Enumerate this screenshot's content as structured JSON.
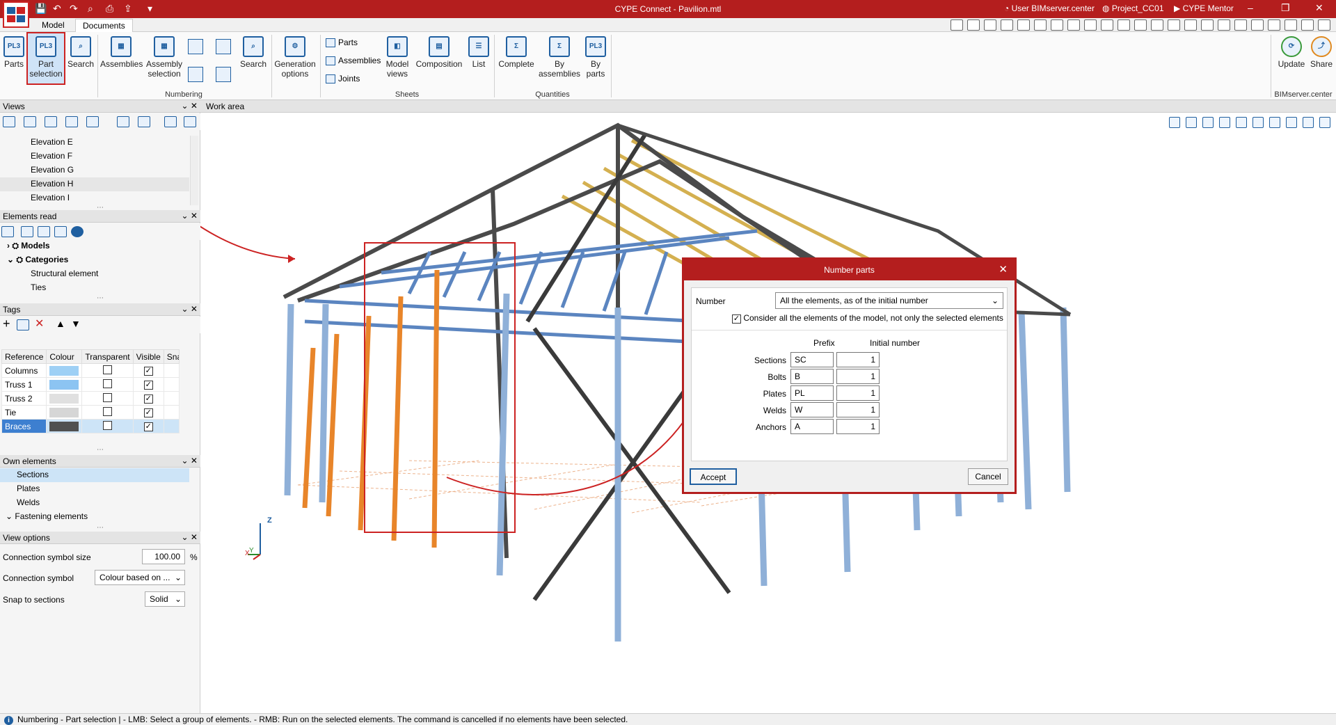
{
  "titlebar": {
    "title": "CYPE Connect - Pavilion.mtl",
    "user": "User BIMserver.center",
    "project": "Project_CC01",
    "mentor": "CYPE Mentor"
  },
  "tabs": [
    "Model",
    "Documents"
  ],
  "ribbon": {
    "parts": "Parts",
    "part_selection_1": "Part",
    "part_selection_2": "selection",
    "search": "Search",
    "assemblies": "Assemblies",
    "assembly_selection_1": "Assembly",
    "assembly_selection_2": "selection",
    "search2": "Search",
    "generation_1": "Generation",
    "generation_2": "options",
    "sheets_parts": "Parts",
    "sheets_assemblies": "Assemblies",
    "sheets_joints": "Joints",
    "model_views_1": "Model",
    "model_views_2": "views",
    "composition": "Composition",
    "list": "List",
    "complete": "Complete",
    "by_assemblies_1": "By",
    "by_assemblies_2": "assemblies",
    "by_parts_1": "By",
    "by_parts_2": "parts",
    "update": "Update",
    "share": "Share",
    "groups": {
      "numbering": "Numbering",
      "sheets": "Sheets",
      "quantities": "Quantities",
      "bimserver": "BIMserver.center"
    }
  },
  "panels": {
    "views": {
      "title": "Views",
      "items": [
        "Elevation E",
        "Elevation F",
        "Elevation G",
        "Elevation H",
        "Elevation I"
      ]
    },
    "elements_read": {
      "title": "Elements read",
      "models": "Models",
      "categories": "Categories",
      "structural": "Structural element",
      "ties": "Ties"
    },
    "tags": {
      "title": "Tags",
      "headers": [
        "Reference",
        "Colour",
        "Transparent",
        "Visible",
        "Snap"
      ],
      "rows": [
        {
          "ref": "Columns",
          "color": "#9ed0f5",
          "transparent": false,
          "visible": true
        },
        {
          "ref": "Truss 1",
          "color": "#8cc4f2",
          "transparent": false,
          "visible": true
        },
        {
          "ref": "Truss 2",
          "color": "#e0e0e0",
          "transparent": false,
          "visible": true
        },
        {
          "ref": "Tie",
          "color": "#d6d6d6",
          "transparent": false,
          "visible": true
        },
        {
          "ref": "Braces",
          "color": "#505050",
          "transparent": false,
          "visible": true
        }
      ]
    },
    "own_elements": {
      "title": "Own elements",
      "items": [
        "Sections",
        "Plates",
        "Welds",
        "Fastening elements"
      ]
    },
    "view_options": {
      "title": "View options",
      "symbol_size_label": "Connection symbol size",
      "symbol_size_value": "100.00",
      "symbol_size_unit": "%",
      "symbol_label": "Connection symbol",
      "symbol_value": "Colour based on ...",
      "snap_label": "Snap to sections",
      "snap_value": "Solid"
    }
  },
  "workarea": {
    "title": "Work area",
    "axis_z": "Z",
    "axis_x": "X",
    "axis_y": "Y"
  },
  "dialog": {
    "title": "Number parts",
    "number_label": "Number",
    "number_value": "All the elements, as of the initial number",
    "consider_label": "Consider all the elements of the model, not only the selected elements",
    "prefix_header": "Prefix",
    "initial_header": "Initial number",
    "rows": [
      {
        "label": "Sections",
        "prefix": "SC",
        "initial": "1"
      },
      {
        "label": "Bolts",
        "prefix": "B",
        "initial": "1"
      },
      {
        "label": "Plates",
        "prefix": "PL",
        "initial": "1"
      },
      {
        "label": "Welds",
        "prefix": "W",
        "initial": "1"
      },
      {
        "label": "Anchors",
        "prefix": "A",
        "initial": "1"
      }
    ],
    "accept": "Accept",
    "cancel": "Cancel"
  },
  "status": {
    "text": "Numbering - Part selection  |  - LMB: Select a group of elements. - RMB: Run on the selected elements. The command is cancelled if no elements have been selected."
  },
  "colors": {
    "brand_red": "#b41e1e",
    "accent_blue": "#1f5fa0",
    "highlight_orange": "#e8852a"
  }
}
